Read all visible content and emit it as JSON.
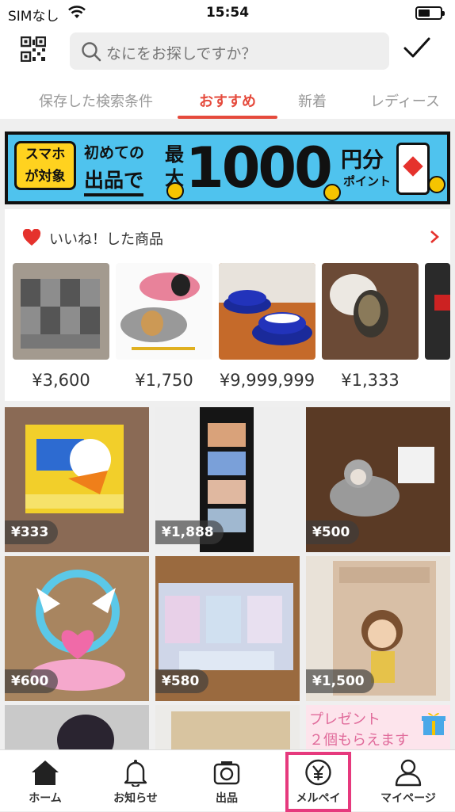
{
  "status_bar": {
    "carrier": "SIMなし",
    "time": "15:54"
  },
  "search": {
    "placeholder": "なにをお探しですか？"
  },
  "tabs": [
    {
      "label": "保存した検索条件",
      "active": false
    },
    {
      "label": "おすすめ",
      "active": true
    },
    {
      "label": "新着",
      "active": false
    },
    {
      "label": "レディース",
      "active": false
    }
  ],
  "banner": {
    "tag_line1": "スマホ",
    "tag_line2": "が対象",
    "caption1": "初めての",
    "caption2": "出品で",
    "max": "最大",
    "amount": "1000",
    "unit": "円分",
    "point": "ポイント"
  },
  "liked": {
    "title": "いいね！した商品",
    "items": [
      {
        "price": "¥3,600"
      },
      {
        "price": "¥1,750"
      },
      {
        "price": "¥9,999,999"
      },
      {
        "price": "¥1,333"
      }
    ]
  },
  "grid": [
    {
      "price": "¥333"
    },
    {
      "price": "¥1,888"
    },
    {
      "price": "¥500"
    },
    {
      "price": "¥600"
    },
    {
      "price": "¥580"
    },
    {
      "price": "¥1,500"
    }
  ],
  "grid_bottom": {
    "promo_line1": "プレゼント",
    "promo_line2": "２個もらえます"
  },
  "tabbar": [
    {
      "label": "ホーム",
      "icon": "home-icon"
    },
    {
      "label": "お知らせ",
      "icon": "bell-icon"
    },
    {
      "label": "出品",
      "icon": "camera-icon"
    },
    {
      "label": "メルペイ",
      "icon": "yen-coin-icon"
    },
    {
      "label": "マイページ",
      "icon": "person-icon"
    }
  ],
  "colors": {
    "accent": "#e54a3c",
    "highlight": "#e6397d",
    "banner_bg": "#4fc3ee"
  }
}
